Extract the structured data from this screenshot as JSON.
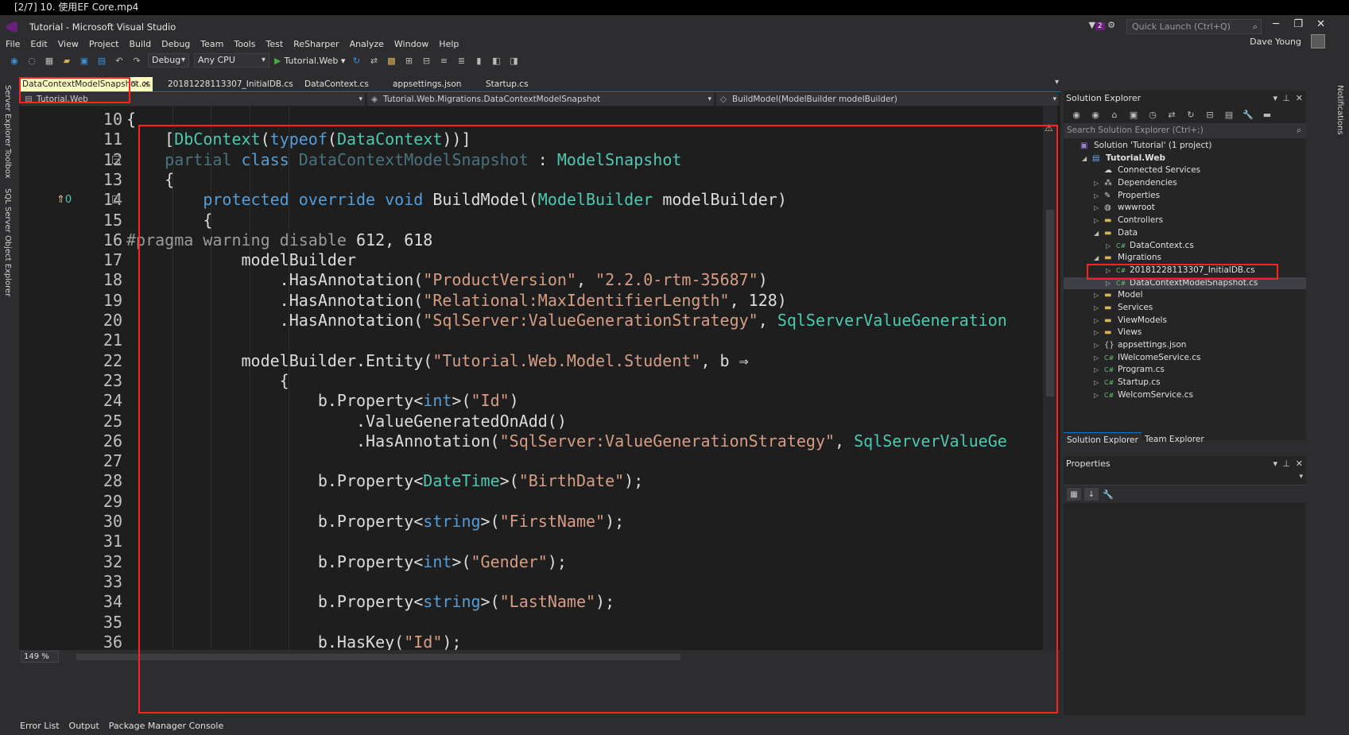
{
  "video_title": "[2/7] 10. 使用EF Core.mp4",
  "window_title": "Tutorial - Microsoft Visual Studio",
  "quick_launch": "Quick Launch (Ctrl+Q)",
  "filter_badge": "2",
  "user_name": "Dave Young",
  "menu": [
    "File",
    "Edit",
    "View",
    "Project",
    "Build",
    "Debug",
    "Team",
    "Tools",
    "Test",
    "ReSharper",
    "Analyze",
    "Window",
    "Help"
  ],
  "toolbar": {
    "config": "Debug",
    "platform": "Any CPU",
    "run_target": "Tutorial.Web"
  },
  "left_tool_tabs": [
    "Server Explorer",
    "Toolbox",
    "SQL Server Object Explorer"
  ],
  "right_tool_tabs": [
    "Notifications"
  ],
  "tabs": [
    "DataContextModelSnapshot.cs",
    "20181228113307_InitialDB.cs",
    "DataContext.cs",
    "appsettings.json",
    "Startup.cs"
  ],
  "nav": {
    "project": "Tutorial.Web",
    "type": "Tutorial.Web.Migrations.DataContextModelSnapshot",
    "member": "BuildModel(ModelBuilder modelBuilder)"
  },
  "code_lines": [
    {
      "n": "10",
      "segs": [
        {
          "t": "{",
          "c": ""
        }
      ]
    },
    {
      "n": "11",
      "segs": [
        {
          "t": "    [",
          "c": ""
        },
        {
          "t": "DbContext",
          "c": "ty"
        },
        {
          "t": "(",
          "c": ""
        },
        {
          "t": "typeof",
          "c": "kw"
        },
        {
          "t": "(",
          "c": ""
        },
        {
          "t": "DataContext",
          "c": "ty"
        },
        {
          "t": "))]",
          "c": ""
        }
      ]
    },
    {
      "n": "12",
      "segs": [
        {
          "t": "    ",
          "c": ""
        },
        {
          "t": "partial",
          "c": "dim"
        },
        {
          "t": " ",
          "c": ""
        },
        {
          "t": "class",
          "c": "kw"
        },
        {
          "t": " ",
          "c": ""
        },
        {
          "t": "DataContextModelSnapshot",
          "c": "dim"
        },
        {
          "t": " : ",
          "c": ""
        },
        {
          "t": "ModelSnapshot",
          "c": "ty"
        }
      ]
    },
    {
      "n": "13",
      "segs": [
        {
          "t": "    {",
          "c": ""
        }
      ]
    },
    {
      "n": "14",
      "segs": [
        {
          "t": "        ",
          "c": ""
        },
        {
          "t": "protected",
          "c": "kw"
        },
        {
          "t": " ",
          "c": ""
        },
        {
          "t": "override",
          "c": "kw"
        },
        {
          "t": " ",
          "c": ""
        },
        {
          "t": "void",
          "c": "kw"
        },
        {
          "t": " BuildModel(",
          "c": ""
        },
        {
          "t": "ModelBuilder",
          "c": "ty"
        },
        {
          "t": " modelBuilder)",
          "c": ""
        }
      ]
    },
    {
      "n": "15",
      "segs": [
        {
          "t": "        {",
          "c": ""
        }
      ]
    },
    {
      "n": "16",
      "segs": [
        {
          "t": "#pragma warning disable",
          "c": "pp"
        },
        {
          "t": " 612, 618",
          "c": ""
        }
      ]
    },
    {
      "n": "17",
      "segs": [
        {
          "t": "            modelBuilder",
          "c": ""
        }
      ]
    },
    {
      "n": "18",
      "segs": [
        {
          "t": "                .HasAnnotation(",
          "c": ""
        },
        {
          "t": "\"ProductVersion\"",
          "c": "st"
        },
        {
          "t": ", ",
          "c": ""
        },
        {
          "t": "\"2.2.0-rtm-35687\"",
          "c": "st"
        },
        {
          "t": ")",
          "c": ""
        }
      ]
    },
    {
      "n": "19",
      "segs": [
        {
          "t": "                .HasAnnotation(",
          "c": ""
        },
        {
          "t": "\"Relational:MaxIdentifierLength\"",
          "c": "st"
        },
        {
          "t": ", 128)",
          "c": ""
        }
      ]
    },
    {
      "n": "20",
      "segs": [
        {
          "t": "                .HasAnnotation(",
          "c": ""
        },
        {
          "t": "\"SqlServer:ValueGenerationStrategy\"",
          "c": "st"
        },
        {
          "t": ", ",
          "c": ""
        },
        {
          "t": "SqlServerValueGeneration",
          "c": "ty"
        }
      ]
    },
    {
      "n": "21",
      "segs": [
        {
          "t": "",
          "c": ""
        }
      ]
    },
    {
      "n": "22",
      "segs": [
        {
          "t": "            modelBuilder.Entity(",
          "c": ""
        },
        {
          "t": "\"Tutorial.Web.Model.Student\"",
          "c": "st"
        },
        {
          "t": ", b ⇒",
          "c": ""
        }
      ]
    },
    {
      "n": "23",
      "segs": [
        {
          "t": "                {",
          "c": ""
        }
      ]
    },
    {
      "n": "24",
      "segs": [
        {
          "t": "                    b.Property<",
          "c": ""
        },
        {
          "t": "int",
          "c": "kw"
        },
        {
          "t": ">(",
          "c": ""
        },
        {
          "t": "\"Id\"",
          "c": "st"
        },
        {
          "t": ")",
          "c": ""
        }
      ]
    },
    {
      "n": "25",
      "segs": [
        {
          "t": "                        .ValueGeneratedOnAdd()",
          "c": ""
        }
      ]
    },
    {
      "n": "26",
      "segs": [
        {
          "t": "                        .HasAnnotation(",
          "c": ""
        },
        {
          "t": "\"SqlServer:ValueGenerationStrategy\"",
          "c": "st"
        },
        {
          "t": ", ",
          "c": ""
        },
        {
          "t": "SqlServerValueGe",
          "c": "ty"
        }
      ]
    },
    {
      "n": "27",
      "segs": [
        {
          "t": "",
          "c": ""
        }
      ]
    },
    {
      "n": "28",
      "segs": [
        {
          "t": "                    b.Property<",
          "c": ""
        },
        {
          "t": "DateTime",
          "c": "ty"
        },
        {
          "t": ">(",
          "c": ""
        },
        {
          "t": "\"BirthDate\"",
          "c": "st"
        },
        {
          "t": ");",
          "c": ""
        }
      ]
    },
    {
      "n": "29",
      "segs": [
        {
          "t": "",
          "c": ""
        }
      ]
    },
    {
      "n": "30",
      "segs": [
        {
          "t": "                    b.Property<",
          "c": ""
        },
        {
          "t": "string",
          "c": "kw"
        },
        {
          "t": ">(",
          "c": ""
        },
        {
          "t": "\"FirstName\"",
          "c": "st"
        },
        {
          "t": ");",
          "c": ""
        }
      ]
    },
    {
      "n": "31",
      "segs": [
        {
          "t": "",
          "c": ""
        }
      ]
    },
    {
      "n": "32",
      "segs": [
        {
          "t": "                    b.Property<",
          "c": ""
        },
        {
          "t": "int",
          "c": "kw"
        },
        {
          "t": ">(",
          "c": ""
        },
        {
          "t": "\"Gender\"",
          "c": "st"
        },
        {
          "t": ");",
          "c": ""
        }
      ]
    },
    {
      "n": "33",
      "segs": [
        {
          "t": "",
          "c": ""
        }
      ]
    },
    {
      "n": "34",
      "segs": [
        {
          "t": "                    b.Property<",
          "c": ""
        },
        {
          "t": "string",
          "c": "kw"
        },
        {
          "t": ">(",
          "c": ""
        },
        {
          "t": "\"LastName\"",
          "c": "st"
        },
        {
          "t": ");",
          "c": ""
        }
      ]
    },
    {
      "n": "35",
      "segs": [
        {
          "t": "",
          "c": ""
        }
      ]
    },
    {
      "n": "36",
      "segs": [
        {
          "t": "                    b.HasKey(",
          "c": ""
        },
        {
          "t": "\"Id\"",
          "c": "st"
        },
        {
          "t": ");",
          "c": ""
        }
      ]
    }
  ],
  "codelens_count": "0",
  "zoom": "149 %",
  "solution_explorer": {
    "title": "Solution Explorer",
    "search": "Search Solution Explorer (Ctrl+;)",
    "items": [
      {
        "label": "Solution 'Tutorial' (1 project)",
        "depth": 0,
        "arrow": "",
        "icon": "sln"
      },
      {
        "label": "Tutorial.Web",
        "depth": 1,
        "arrow": "◢",
        "icon": "proj"
      },
      {
        "label": "Connected Services",
        "depth": 2,
        "arrow": "",
        "icon": "cloud"
      },
      {
        "label": "Dependencies",
        "depth": 2,
        "arrow": "▷",
        "icon": "deps"
      },
      {
        "label": "Properties",
        "depth": 2,
        "arrow": "▷",
        "icon": "wrench"
      },
      {
        "label": "wwwroot",
        "depth": 2,
        "arrow": "▷",
        "icon": "globe"
      },
      {
        "label": "Controllers",
        "depth": 2,
        "arrow": "▷",
        "icon": "folder"
      },
      {
        "label": "Data",
        "depth": 2,
        "arrow": "◢",
        "icon": "folder"
      },
      {
        "label": "DataContext.cs",
        "depth": 3,
        "arrow": "▷",
        "icon": "cs"
      },
      {
        "label": "Migrations",
        "depth": 2,
        "arrow": "◢",
        "icon": "folder"
      },
      {
        "label": "20181228113307_InitialDB.cs",
        "depth": 3,
        "arrow": "▷",
        "icon": "cs"
      },
      {
        "label": "DataContextModelSnapshot.cs",
        "depth": 3,
        "arrow": "▷",
        "icon": "cs",
        "selected": true
      },
      {
        "label": "Model",
        "depth": 2,
        "arrow": "▷",
        "icon": "folder"
      },
      {
        "label": "Services",
        "depth": 2,
        "arrow": "▷",
        "icon": "folder"
      },
      {
        "label": "ViewModels",
        "depth": 2,
        "arrow": "▷",
        "icon": "folder"
      },
      {
        "label": "Views",
        "depth": 2,
        "arrow": "▷",
        "icon": "folder"
      },
      {
        "label": "appsettings.json",
        "depth": 2,
        "arrow": "▷",
        "icon": "json"
      },
      {
        "label": "IWelcomeService.cs",
        "depth": 2,
        "arrow": "▷",
        "icon": "cs"
      },
      {
        "label": "Program.cs",
        "depth": 2,
        "arrow": "▷",
        "icon": "cs"
      },
      {
        "label": "Startup.cs",
        "depth": 2,
        "arrow": "▷",
        "icon": "cs"
      },
      {
        "label": "WelcomService.cs",
        "depth": 2,
        "arrow": "▷",
        "icon": "cs"
      }
    ],
    "tabs": [
      "Solution Explorer",
      "Team Explorer"
    ]
  },
  "properties": {
    "title": "Properties"
  },
  "status_tabs": [
    "Error List",
    "Output",
    "Package Manager Console"
  ],
  "colors": {
    "highlight_box": "#ff2020",
    "active_tab": "#fefcc3",
    "accent": "#007acc"
  }
}
